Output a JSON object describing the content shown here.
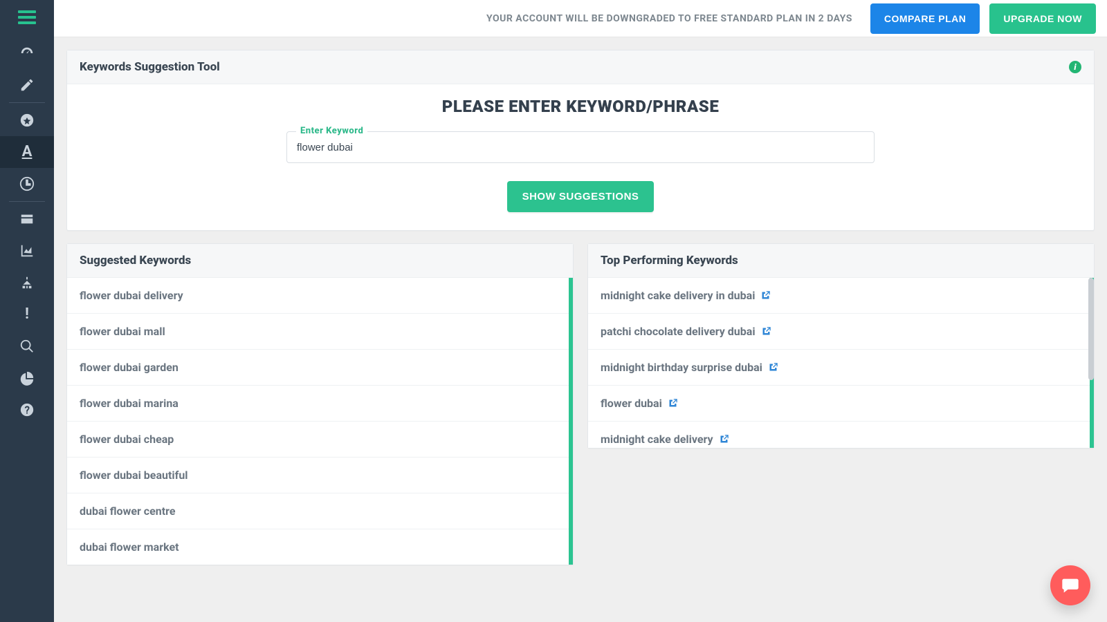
{
  "topbar": {
    "message": "YOUR ACCOUNT WILL BE DOWNGRADED TO FREE STANDARD PLAN IN 2 DAYS",
    "compare_label": "COMPARE PLAN",
    "upgrade_label": "UPGRADE NOW"
  },
  "tool_card": {
    "title": "Keywords Suggestion Tool",
    "search_heading": "PLEASE ENTER KEYWORD/PHRASE",
    "input_label": "Enter Keyword",
    "input_value": "flower dubai",
    "button_label": "SHOW SUGGESTIONS"
  },
  "suggested": {
    "title": "Suggested Keywords",
    "items": [
      "flower dubai delivery",
      "flower dubai mall",
      "flower dubai garden",
      "flower dubai marina",
      "flower dubai cheap",
      "flower dubai beautiful",
      "dubai flower centre",
      "dubai flower market"
    ]
  },
  "top_performing": {
    "title": "Top Performing Keywords",
    "items": [
      "midnight cake delivery in dubai",
      "patchi chocolate delivery dubai",
      "midnight birthday surprise dubai",
      "flower dubai",
      "midnight cake delivery"
    ]
  },
  "sidebar": {
    "items": [
      {
        "name": "dashboard-icon"
      },
      {
        "name": "edit-icon"
      },
      {
        "name": "star-icon"
      },
      {
        "name": "text-icon"
      },
      {
        "name": "clock-icon"
      },
      {
        "name": "card-icon"
      },
      {
        "name": "chart-icon"
      },
      {
        "name": "sitemap-icon"
      },
      {
        "name": "alert-icon"
      },
      {
        "name": "search-icon"
      },
      {
        "name": "pie-icon"
      },
      {
        "name": "help-icon"
      }
    ]
  }
}
